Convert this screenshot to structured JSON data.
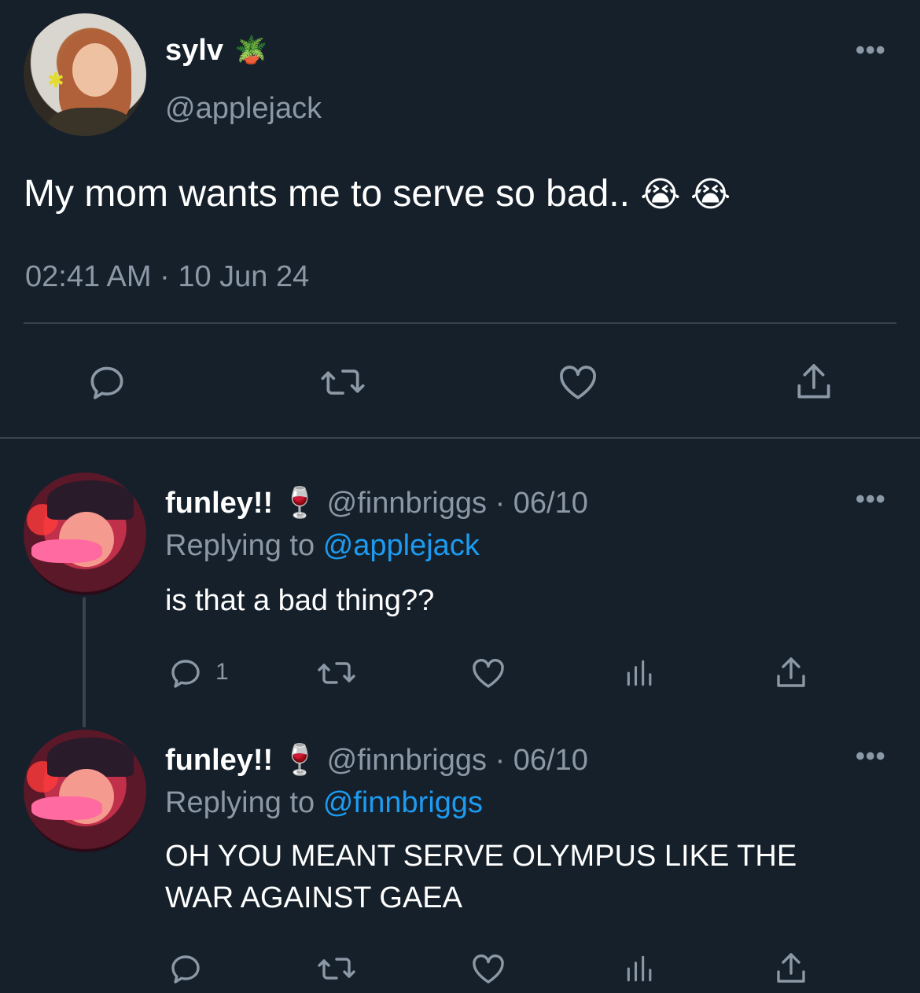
{
  "main_tweet": {
    "display_name": "sylv",
    "name_emoji": "🪴",
    "handle": "@applejack",
    "text": "My mom wants me to serve so bad..",
    "text_emojis": "😭 😭",
    "timestamp": "02:41 AM · 10 Jun 24",
    "more_label": "•••"
  },
  "replies": [
    {
      "display_name": "funley!!",
      "name_emoji": "🍷",
      "handle": "@finnbriggs",
      "date": "· 06/10",
      "replying_to_label": "Replying to",
      "replying_to_handle": "@applejack",
      "text": "is that a bad thing??",
      "reply_count": "1",
      "more_label": "•••"
    },
    {
      "display_name": "funley!!",
      "name_emoji": "🍷",
      "handle": "@finnbriggs",
      "date": "· 06/10",
      "replying_to_label": "Replying to",
      "replying_to_handle": "@finnbriggs",
      "text_line1": "OH YOU MEANT SERVE OLYMPUS LIKE THE",
      "text_line2": "WAR AGAINST GAEA",
      "more_label": "•••"
    }
  ],
  "colors": {
    "background": "#15202b",
    "secondary_text": "#8b98a5",
    "accent": "#1d9bf0",
    "divider": "#38444d"
  },
  "icons": [
    "reply-icon",
    "retweet-icon",
    "like-icon",
    "share-icon",
    "views-icon",
    "more-icon"
  ]
}
